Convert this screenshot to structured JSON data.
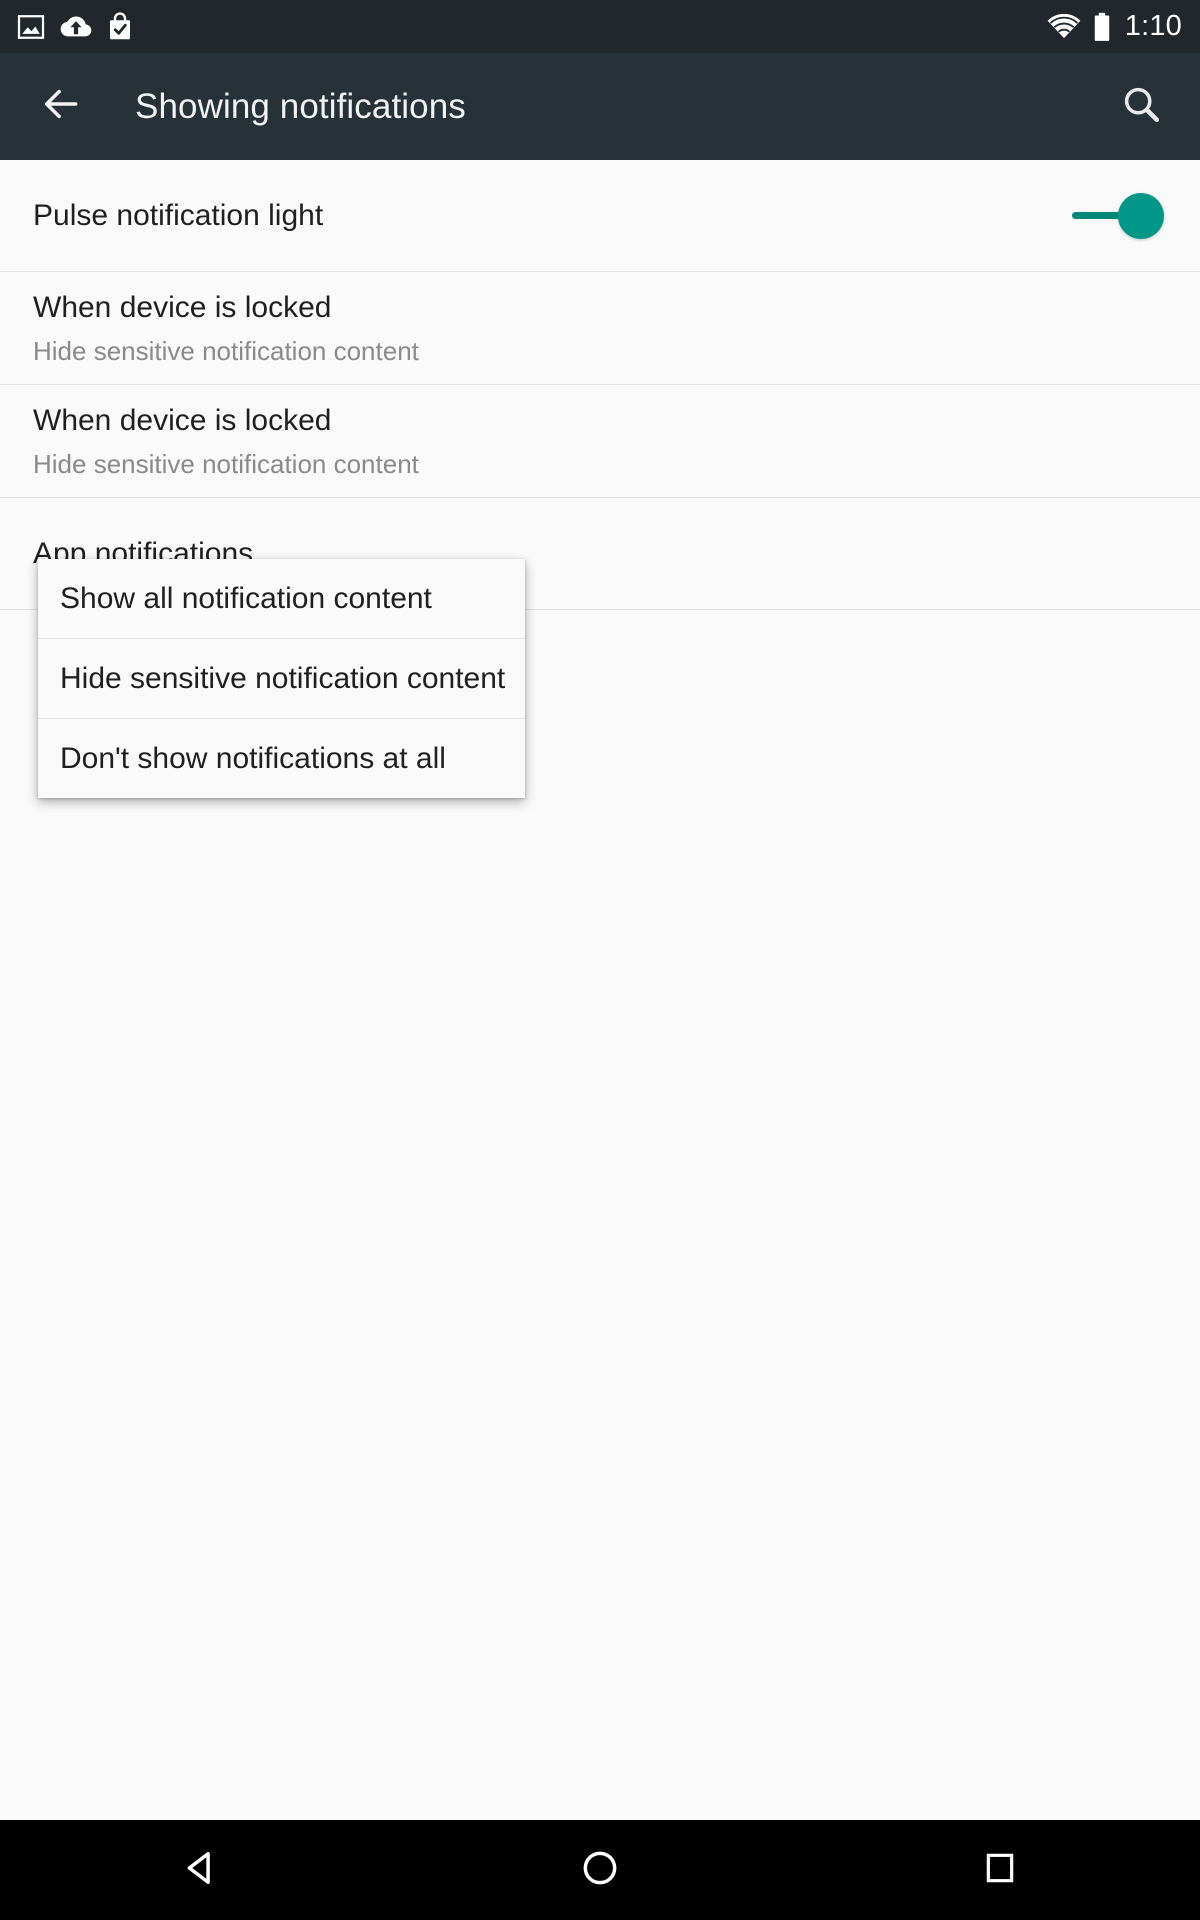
{
  "status_bar": {
    "icons": [
      "image-icon",
      "cloud-upload-icon",
      "play-store-bag-check-icon",
      "wifi-icon",
      "battery-full-icon"
    ],
    "time": "1:10",
    "background_color": "#21272b"
  },
  "app_bar": {
    "back_icon": "arrow-back-icon",
    "title": "Showing notifications",
    "search_icon": "search-icon",
    "background_color": "#263238"
  },
  "settings_rows": [
    {
      "title": "Pulse notification light",
      "subtitle": "",
      "control": "switch",
      "switch_on": true,
      "switch_color": "#009688"
    },
    {
      "title": "When device is locked",
      "subtitle": "Hide sensitive notification content",
      "control": "none"
    },
    {
      "title": "When device is locked",
      "subtitle": "Hide sensitive notification content",
      "control": "none"
    },
    {
      "title": "App notifications",
      "subtitle": "",
      "control": "none"
    }
  ],
  "popup_menu": {
    "visible": true,
    "items": [
      "Show all notification content",
      "Hide sensitive notification content",
      "Don't show notifications at all"
    ]
  },
  "nav_bar": {
    "back": "nav-back-icon",
    "home": "nav-home-icon",
    "recents": "nav-recents-icon",
    "background_color": "#000000"
  }
}
